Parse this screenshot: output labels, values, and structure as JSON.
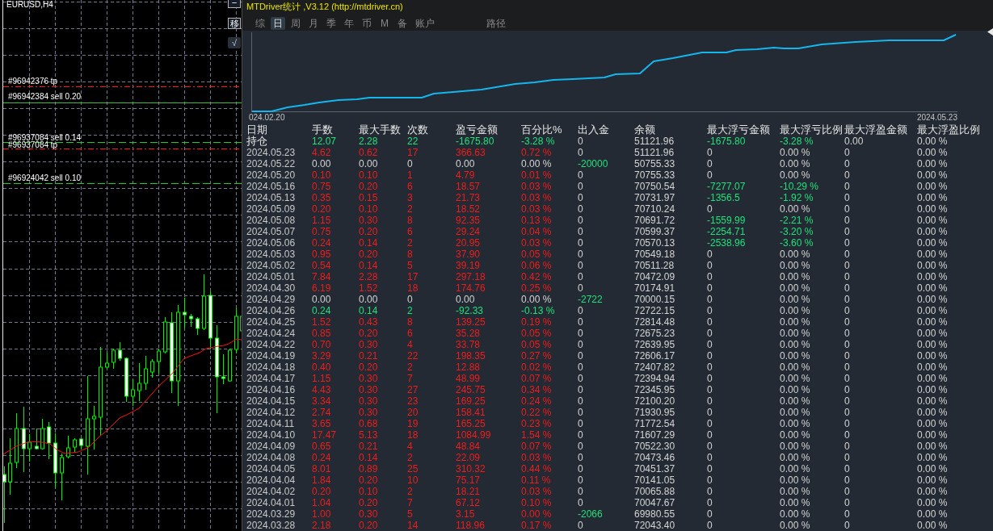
{
  "chart_window": {
    "title": "EURUSD,H4",
    "buttons": [
      {
        "label": "−",
        "pressed": false
      },
      {
        "label": "移",
        "pressed": false
      },
      {
        "label": "√",
        "pressed": true
      }
    ],
    "orders": [
      {
        "label": "#96942376 tp",
        "kind": "tp"
      },
      {
        "label": "#96942384 sell 0.20",
        "kind": "sell"
      },
      {
        "label": "#96937084 sell 0.14",
        "kind": "sell"
      },
      {
        "label": "#96937084 tp",
        "kind": "tp"
      },
      {
        "label": "#96924042 sell 0.10",
        "kind": "sell"
      }
    ]
  },
  "stats_panel": {
    "title": "MTDriver统计 ,V3.12 (http://mtdriver.cn)",
    "tabs": [
      {
        "label": "综",
        "selected": false
      },
      {
        "label": "日",
        "selected": true
      },
      {
        "label": "周",
        "selected": false
      },
      {
        "label": "月",
        "selected": false
      },
      {
        "label": "季",
        "selected": false
      },
      {
        "label": "年",
        "selected": false
      },
      {
        "label": "币",
        "selected": false
      },
      {
        "label": "M",
        "selected": false
      },
      {
        "label": "备",
        "selected": false
      },
      {
        "label": "账户",
        "selected": false
      }
    ],
    "side_tabs": [
      {
        "label": "路径",
        "selected": false
      }
    ],
    "equity_chart": {
      "x_labels": [
        "024.02.20",
        "2024.05.23"
      ]
    },
    "table": {
      "columns": [
        "日期",
        "手数",
        "最大手数",
        "次数",
        "盈亏金额",
        "百分比%",
        "出入金",
        "余额",
        "最大浮亏金额",
        "最大浮亏比例",
        "最大浮盈金额",
        "最大浮盈比例"
      ],
      "rows": [
        {
          "kind": "summary",
          "cells": [
            "持仓",
            "12.07",
            "2.28",
            "22",
            "-1675.80",
            "-3.28 %",
            "0",
            "51121.96",
            "-1675.80",
            "-3.28 %",
            "0.00",
            "0.00 %"
          ],
          "gain": false,
          "loss": true,
          "cash_out": false,
          "drawdown": true
        },
        {
          "kind": "day",
          "cells": [
            "2024.05.23",
            "4.62",
            "0.62",
            "17",
            "366.63",
            "0.72 %",
            "0",
            "51121.96",
            "0",
            "0.00 %",
            "0",
            "0.00 %"
          ],
          "gain": true,
          "loss": false,
          "cash_out": false,
          "drawdown": false
        },
        {
          "kind": "day",
          "cells": [
            "2024.05.22",
            "0.00",
            "0.00",
            "0",
            "0.00",
            "0.00 %",
            "-20000",
            "50755.33",
            "0",
            "0.00 %",
            "0",
            "0.00 %"
          ],
          "gain": false,
          "loss": false,
          "cash_out": true,
          "drawdown": false
        },
        {
          "kind": "day",
          "cells": [
            "2024.05.20",
            "0.10",
            "0.10",
            "1",
            "4.79",
            "0.01 %",
            "0",
            "70755.33",
            "0",
            "0.00 %",
            "0",
            "0.00 %"
          ],
          "gain": true,
          "loss": false,
          "cash_out": false,
          "drawdown": false
        },
        {
          "kind": "day",
          "cells": [
            "2024.05.16",
            "0.75",
            "0.20",
            "6",
            "18.57",
            "0.03 %",
            "0",
            "70750.54",
            "-7277.07",
            "-10.29 %",
            "0",
            "0.00 %"
          ],
          "gain": true,
          "loss": false,
          "cash_out": false,
          "drawdown": true
        },
        {
          "kind": "day",
          "cells": [
            "2024.05.13",
            "0.35",
            "0.15",
            "3",
            "21.73",
            "0.03 %",
            "0",
            "70731.97",
            "-1356.5",
            "-1.92 %",
            "0",
            "0.00 %"
          ],
          "gain": true,
          "loss": false,
          "cash_out": false,
          "drawdown": true
        },
        {
          "kind": "day",
          "cells": [
            "2024.05.09",
            "0.20",
            "0.10",
            "2",
            "18.52",
            "0.03 %",
            "0",
            "70710.24",
            "0",
            "0.00 %",
            "0",
            "0.00 %"
          ],
          "gain": true,
          "loss": false,
          "cash_out": false,
          "drawdown": false
        },
        {
          "kind": "day",
          "cells": [
            "2024.05.08",
            "1.15",
            "0.30",
            "8",
            "92.35",
            "0.13 %",
            "0",
            "70691.72",
            "-1559.99",
            "-2.21 %",
            "0",
            "0.00 %"
          ],
          "gain": true,
          "loss": false,
          "cash_out": false,
          "drawdown": true
        },
        {
          "kind": "day",
          "cells": [
            "2024.05.07",
            "0.75",
            "0.20",
            "6",
            "29.24",
            "0.04 %",
            "0",
            "70599.37",
            "-2254.71",
            "-3.20 %",
            "0",
            "0.00 %"
          ],
          "gain": true,
          "loss": false,
          "cash_out": false,
          "drawdown": true
        },
        {
          "kind": "day",
          "cells": [
            "2024.05.06",
            "0.24",
            "0.14",
            "2",
            "20.95",
            "0.03 %",
            "0",
            "70570.13",
            "-2538.96",
            "-3.60 %",
            "0",
            "0.00 %"
          ],
          "gain": true,
          "loss": false,
          "cash_out": false,
          "drawdown": true
        },
        {
          "kind": "day",
          "cells": [
            "2024.05.03",
            "0.95",
            "0.20",
            "8",
            "37.90",
            "0.05 %",
            "0",
            "70549.18",
            "0",
            "0.00 %",
            "0",
            "0.00 %"
          ],
          "gain": true,
          "loss": false,
          "cash_out": false,
          "drawdown": false
        },
        {
          "kind": "day",
          "cells": [
            "2024.05.02",
            "0.54",
            "0.14",
            "5",
            "39.19",
            "0.06 %",
            "0",
            "70511.28",
            "0",
            "0.00 %",
            "0",
            "0.00 %"
          ],
          "gain": true,
          "loss": false,
          "cash_out": false,
          "drawdown": false
        },
        {
          "kind": "day",
          "cells": [
            "2024.05.01",
            "7.84",
            "2.28",
            "17",
            "297.18",
            "0.42 %",
            "0",
            "70472.09",
            "0",
            "0.00 %",
            "0",
            "0.00 %"
          ],
          "gain": true,
          "loss": false,
          "cash_out": false,
          "drawdown": false
        },
        {
          "kind": "day",
          "cells": [
            "2024.04.30",
            "6.19",
            "1.52",
            "18",
            "174.76",
            "0.25 %",
            "0",
            "70174.91",
            "0",
            "0.00 %",
            "0",
            "0.00 %"
          ],
          "gain": true,
          "loss": false,
          "cash_out": false,
          "drawdown": false
        },
        {
          "kind": "day",
          "cells": [
            "2024.04.29",
            "0.00",
            "0.00",
            "0",
            "0.00",
            "0.00 %",
            "-2722",
            "70000.15",
            "0",
            "0.00 %",
            "0",
            "0.00 %"
          ],
          "gain": false,
          "loss": false,
          "cash_out": true,
          "drawdown": false
        },
        {
          "kind": "day",
          "cells": [
            "2024.04.26",
            "0.24",
            "0.14",
            "2",
            "-92.33",
            "-0.13 %",
            "0",
            "72722.15",
            "0",
            "0.00 %",
            "0",
            "0.00 %"
          ],
          "gain": false,
          "loss": true,
          "cash_out": false,
          "drawdown": false
        },
        {
          "kind": "day",
          "cells": [
            "2024.04.25",
            "1.52",
            "0.43",
            "8",
            "139.25",
            "0.19 %",
            "0",
            "72814.48",
            "0",
            "0.00 %",
            "0",
            "0.00 %"
          ],
          "gain": true,
          "loss": false,
          "cash_out": false,
          "drawdown": false
        },
        {
          "kind": "day",
          "cells": [
            "2024.04.24",
            "0.85",
            "0.20",
            "6",
            "35.28",
            "0.05 %",
            "0",
            "72675.23",
            "0",
            "0.00 %",
            "0",
            "0.00 %"
          ],
          "gain": true,
          "loss": false,
          "cash_out": false,
          "drawdown": false
        },
        {
          "kind": "day",
          "cells": [
            "2024.04.22",
            "0.70",
            "0.30",
            "4",
            "33.78",
            "0.05 %",
            "0",
            "72639.95",
            "0",
            "0.00 %",
            "0",
            "0.00 %"
          ],
          "gain": true,
          "loss": false,
          "cash_out": false,
          "drawdown": false
        },
        {
          "kind": "day",
          "cells": [
            "2024.04.19",
            "3.29",
            "0.21",
            "22",
            "198.35",
            "0.27 %",
            "0",
            "72606.17",
            "0",
            "0.00 %",
            "0",
            "0.00 %"
          ],
          "gain": true,
          "loss": false,
          "cash_out": false,
          "drawdown": false
        },
        {
          "kind": "day",
          "cells": [
            "2024.04.18",
            "0.40",
            "0.20",
            "2",
            "12.88",
            "0.02 %",
            "0",
            "72407.82",
            "0",
            "0.00 %",
            "0",
            "0.00 %"
          ],
          "gain": true,
          "loss": false,
          "cash_out": false,
          "drawdown": false
        },
        {
          "kind": "day",
          "cells": [
            "2024.04.17",
            "1.15",
            "0.30",
            "7",
            "48.99",
            "0.07 %",
            "0",
            "72394.94",
            "0",
            "0.00 %",
            "0",
            "0.00 %"
          ],
          "gain": true,
          "loss": false,
          "cash_out": false,
          "drawdown": false
        },
        {
          "kind": "day",
          "cells": [
            "2024.04.16",
            "4.43",
            "0.30",
            "27",
            "245.75",
            "0.34 %",
            "0",
            "72345.95",
            "0",
            "0.00 %",
            "0",
            "0.00 %"
          ],
          "gain": true,
          "loss": false,
          "cash_out": false,
          "drawdown": false
        },
        {
          "kind": "day",
          "cells": [
            "2024.04.15",
            "3.34",
            "0.30",
            "23",
            "169.25",
            "0.24 %",
            "0",
            "72100.20",
            "0",
            "0.00 %",
            "0",
            "0.00 %"
          ],
          "gain": true,
          "loss": false,
          "cash_out": false,
          "drawdown": false
        },
        {
          "kind": "day",
          "cells": [
            "2024.04.12",
            "2.74",
            "0.30",
            "20",
            "158.41",
            "0.22 %",
            "0",
            "71930.95",
            "0",
            "0.00 %",
            "0",
            "0.00 %"
          ],
          "gain": true,
          "loss": false,
          "cash_out": false,
          "drawdown": false
        },
        {
          "kind": "day",
          "cells": [
            "2024.04.11",
            "3.65",
            "0.68",
            "19",
            "165.25",
            "0.23 %",
            "0",
            "71772.54",
            "0",
            "0.00 %",
            "0",
            "0.00 %"
          ],
          "gain": true,
          "loss": false,
          "cash_out": false,
          "drawdown": false
        },
        {
          "kind": "day",
          "cells": [
            "2024.04.10",
            "17.47",
            "5.13",
            "18",
            "1084.99",
            "1.54 %",
            "0",
            "71607.29",
            "0",
            "0.00 %",
            "0",
            "0.00 %"
          ],
          "gain": true,
          "loss": false,
          "cash_out": false,
          "drawdown": false
        },
        {
          "kind": "day",
          "cells": [
            "2024.04.09",
            "0.65",
            "0.21",
            "4",
            "48.84",
            "0.07 %",
            "0",
            "70522.30",
            "0",
            "0.00 %",
            "0",
            "0.00 %"
          ],
          "gain": true,
          "loss": false,
          "cash_out": false,
          "drawdown": false
        },
        {
          "kind": "day",
          "cells": [
            "2024.04.08",
            "0.24",
            "0.14",
            "2",
            "22.09",
            "0.03 %",
            "0",
            "70473.46",
            "0",
            "0.00 %",
            "0",
            "0.00 %"
          ],
          "gain": true,
          "loss": false,
          "cash_out": false,
          "drawdown": false
        },
        {
          "kind": "day",
          "cells": [
            "2024.04.05",
            "8.01",
            "0.89",
            "25",
            "310.32",
            "0.44 %",
            "0",
            "70451.37",
            "0",
            "0.00 %",
            "0",
            "0.00 %"
          ],
          "gain": true,
          "loss": false,
          "cash_out": false,
          "drawdown": false
        },
        {
          "kind": "day",
          "cells": [
            "2024.04.04",
            "1.84",
            "0.20",
            "10",
            "75.17",
            "0.11 %",
            "0",
            "70141.05",
            "0",
            "0.00 %",
            "0",
            "0.00 %"
          ],
          "gain": true,
          "loss": false,
          "cash_out": false,
          "drawdown": false
        },
        {
          "kind": "day",
          "cells": [
            "2024.04.02",
            "0.20",
            "0.10",
            "2",
            "18.21",
            "0.03 %",
            "0",
            "70065.88",
            "0",
            "0.00 %",
            "0",
            "0.00 %"
          ],
          "gain": true,
          "loss": false,
          "cash_out": false,
          "drawdown": false
        },
        {
          "kind": "day",
          "cells": [
            "2024.04.01",
            "1.04",
            "0.20",
            "7",
            "67.12",
            "0.10 %",
            "0",
            "70047.67",
            "0",
            "0.00 %",
            "0",
            "0.00 %"
          ],
          "gain": true,
          "loss": false,
          "cash_out": false,
          "drawdown": false
        },
        {
          "kind": "day",
          "cells": [
            "2024.03.29",
            "1.00",
            "0.30",
            "5",
            "3.15",
            "0.00 %",
            "-2066",
            "69980.55",
            "0",
            "0.00 %",
            "0",
            "0.00 %"
          ],
          "gain": true,
          "loss": false,
          "cash_out": true,
          "drawdown": false
        },
        {
          "kind": "day",
          "cells": [
            "2024.03.28",
            "2.18",
            "0.20",
            "14",
            "118.96",
            "0.17 %",
            "0",
            "72043.40",
            "0",
            "0.00 %",
            "0",
            "0.00 %"
          ],
          "gain": true,
          "loss": false,
          "cash_out": false,
          "drawdown": false
        }
      ]
    }
  }
}
